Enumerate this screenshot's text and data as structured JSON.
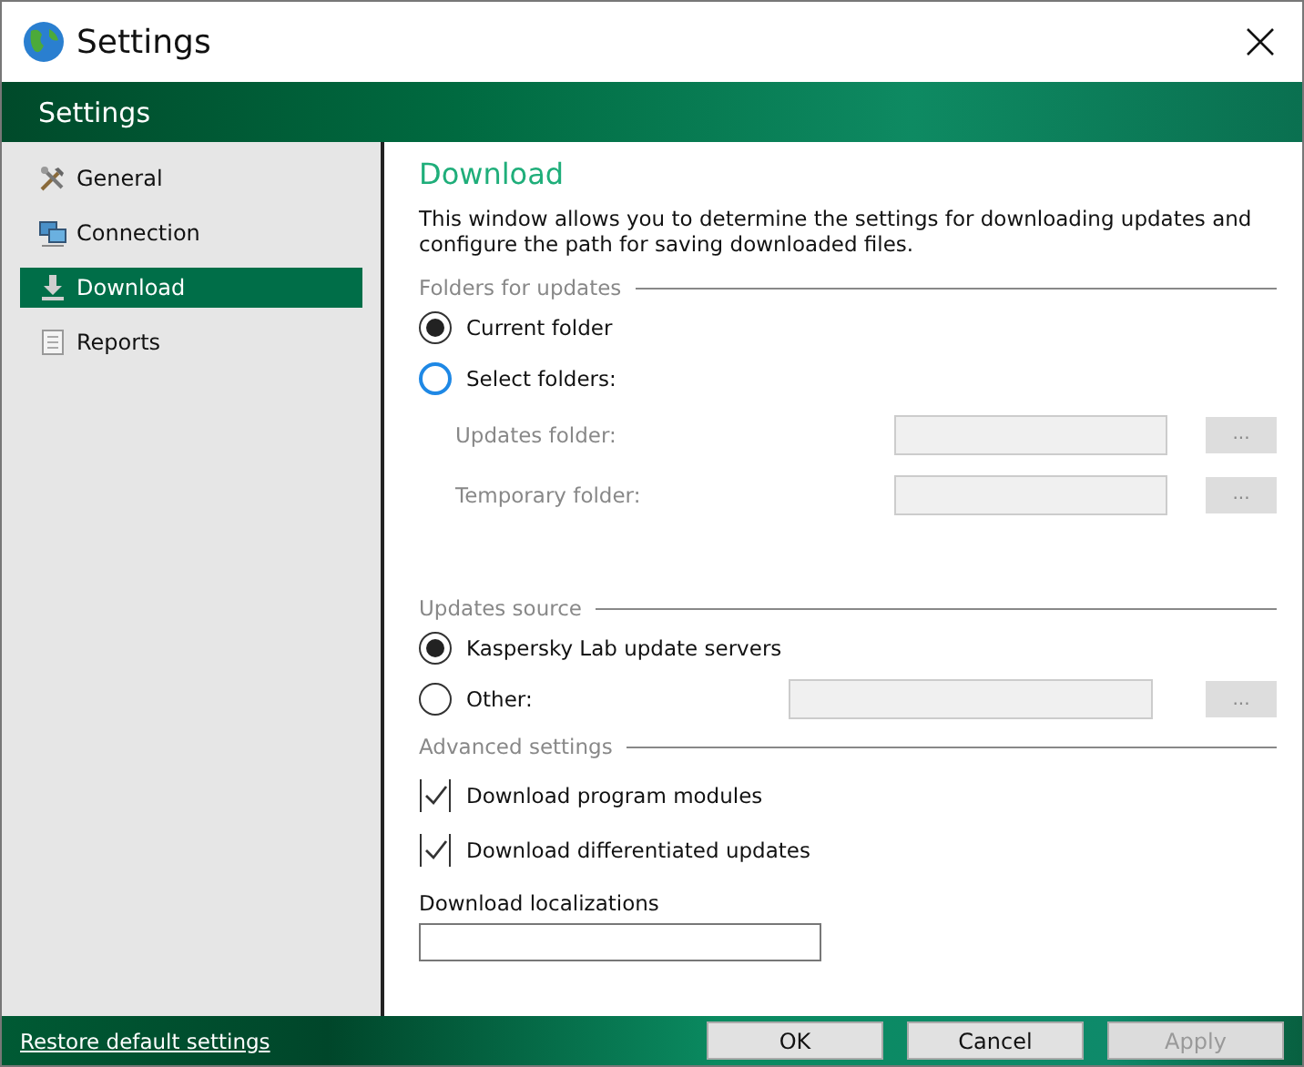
{
  "window": {
    "title": "Settings"
  },
  "header": {
    "title": "Settings"
  },
  "sidebar": {
    "items": [
      {
        "label": "General",
        "selected": false
      },
      {
        "label": "Connection",
        "selected": false
      },
      {
        "label": "Download",
        "selected": true
      },
      {
        "label": "Reports",
        "selected": false
      }
    ]
  },
  "page": {
    "title": "Download",
    "description": "This window allows you to determine the settings for downloading updates and configure the path for saving downloaded files."
  },
  "folders": {
    "legend": "Folders for updates",
    "options": [
      {
        "label": "Current folder",
        "selected": true,
        "focused": false
      },
      {
        "label": "Select folders:",
        "selected": false,
        "focused": true
      }
    ],
    "fields": [
      {
        "label": "Updates folder:",
        "disabled": true,
        "button": "..."
      },
      {
        "label": "Temporary folder:",
        "disabled": true,
        "button": "..."
      }
    ]
  },
  "source": {
    "legend": "Updates source",
    "options": [
      {
        "label": "Kaspersky Lab update servers",
        "selected": true,
        "focused": false
      },
      {
        "label": "Other:",
        "selected": false,
        "focused": false,
        "field": {
          "disabled": true,
          "button": "..."
        }
      }
    ]
  },
  "advanced": {
    "legend": "Advanced settings",
    "checks": [
      {
        "label": "Download program modules",
        "checked": true
      },
      {
        "label": "Download differentiated updates",
        "checked": true
      }
    ],
    "localizations": {
      "label": "Download localizations"
    }
  },
  "footer": {
    "link": "Restore default settings",
    "buttons": [
      {
        "label": "OK",
        "disabled": false
      },
      {
        "label": "Cancel",
        "disabled": false
      },
      {
        "label": "Apply",
        "disabled": true
      }
    ]
  }
}
